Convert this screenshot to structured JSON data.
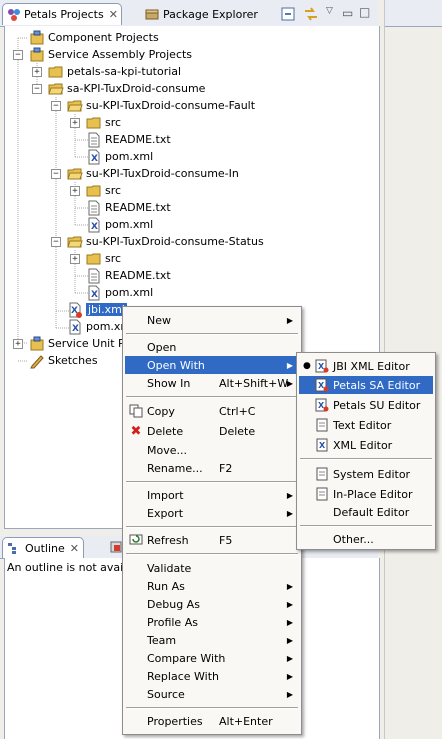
{
  "tabs": {
    "petals_projects": "Petals Projects",
    "package_explorer": "Package Explorer"
  },
  "tree": {
    "component_projects": "Component Projects",
    "service_assembly_projects": "Service Assembly Projects",
    "petals_sa_kpi_tutorial": "petals-sa-kpi-tutorial",
    "sa_kpi": "sa-KPI-TuxDroid-consume",
    "su_fault": "su-KPI-TuxDroid-consume-Fault",
    "su_in": "su-KPI-TuxDroid-consume-In",
    "su_status": "su-KPI-TuxDroid-consume-Status",
    "src": "src",
    "readme": "README.txt",
    "pom": "pom.xml",
    "jbi": "jbi.xml",
    "pom_sa": "pom.xml",
    "service_unit_projects": "Service Unit Projects",
    "sketches": "Sketches"
  },
  "outline": {
    "tab": "Outline",
    "message": "An outline is not available."
  },
  "context_menu": {
    "new": "New",
    "open": "Open",
    "open_with": "Open With",
    "show_in": "Show In",
    "show_in_acc": "Alt+Shift+W",
    "copy": "Copy",
    "copy_acc": "Ctrl+C",
    "delete": "Delete",
    "delete_acc": "Delete",
    "move": "Move...",
    "rename": "Rename...",
    "rename_acc": "F2",
    "import": "Import",
    "export": "Export",
    "refresh": "Refresh",
    "refresh_acc": "F5",
    "validate": "Validate",
    "run_as": "Run As",
    "debug_as": "Debug As",
    "profile_as": "Profile As",
    "team": "Team",
    "compare_with": "Compare With",
    "replace_with": "Replace With",
    "source": "Source",
    "properties": "Properties",
    "properties_acc": "Alt+Enter"
  },
  "submenu": {
    "jbi_xml_editor": "JBI XML Editor",
    "petals_sa_editor": "Petals SA Editor",
    "petals_su_editor": "Petals SU Editor",
    "text_editor": "Text Editor",
    "xml_editor": "XML Editor",
    "system_editor": "System Editor",
    "in_place_editor": "In-Place Editor",
    "default_editor": "Default Editor",
    "other": "Other..."
  },
  "icons": {
    "project": "project-icon",
    "folder": "folder-icon",
    "file": "text-file-icon",
    "xml": "xml-file-icon",
    "sketch": "pencil-icon"
  },
  "colors": {
    "selection": "#316ac5",
    "menu_bg": "#f9f8f4",
    "tab_bar": "#e9ecf3",
    "folder": "#e8c050",
    "xml_blue": "#2a52a8"
  }
}
